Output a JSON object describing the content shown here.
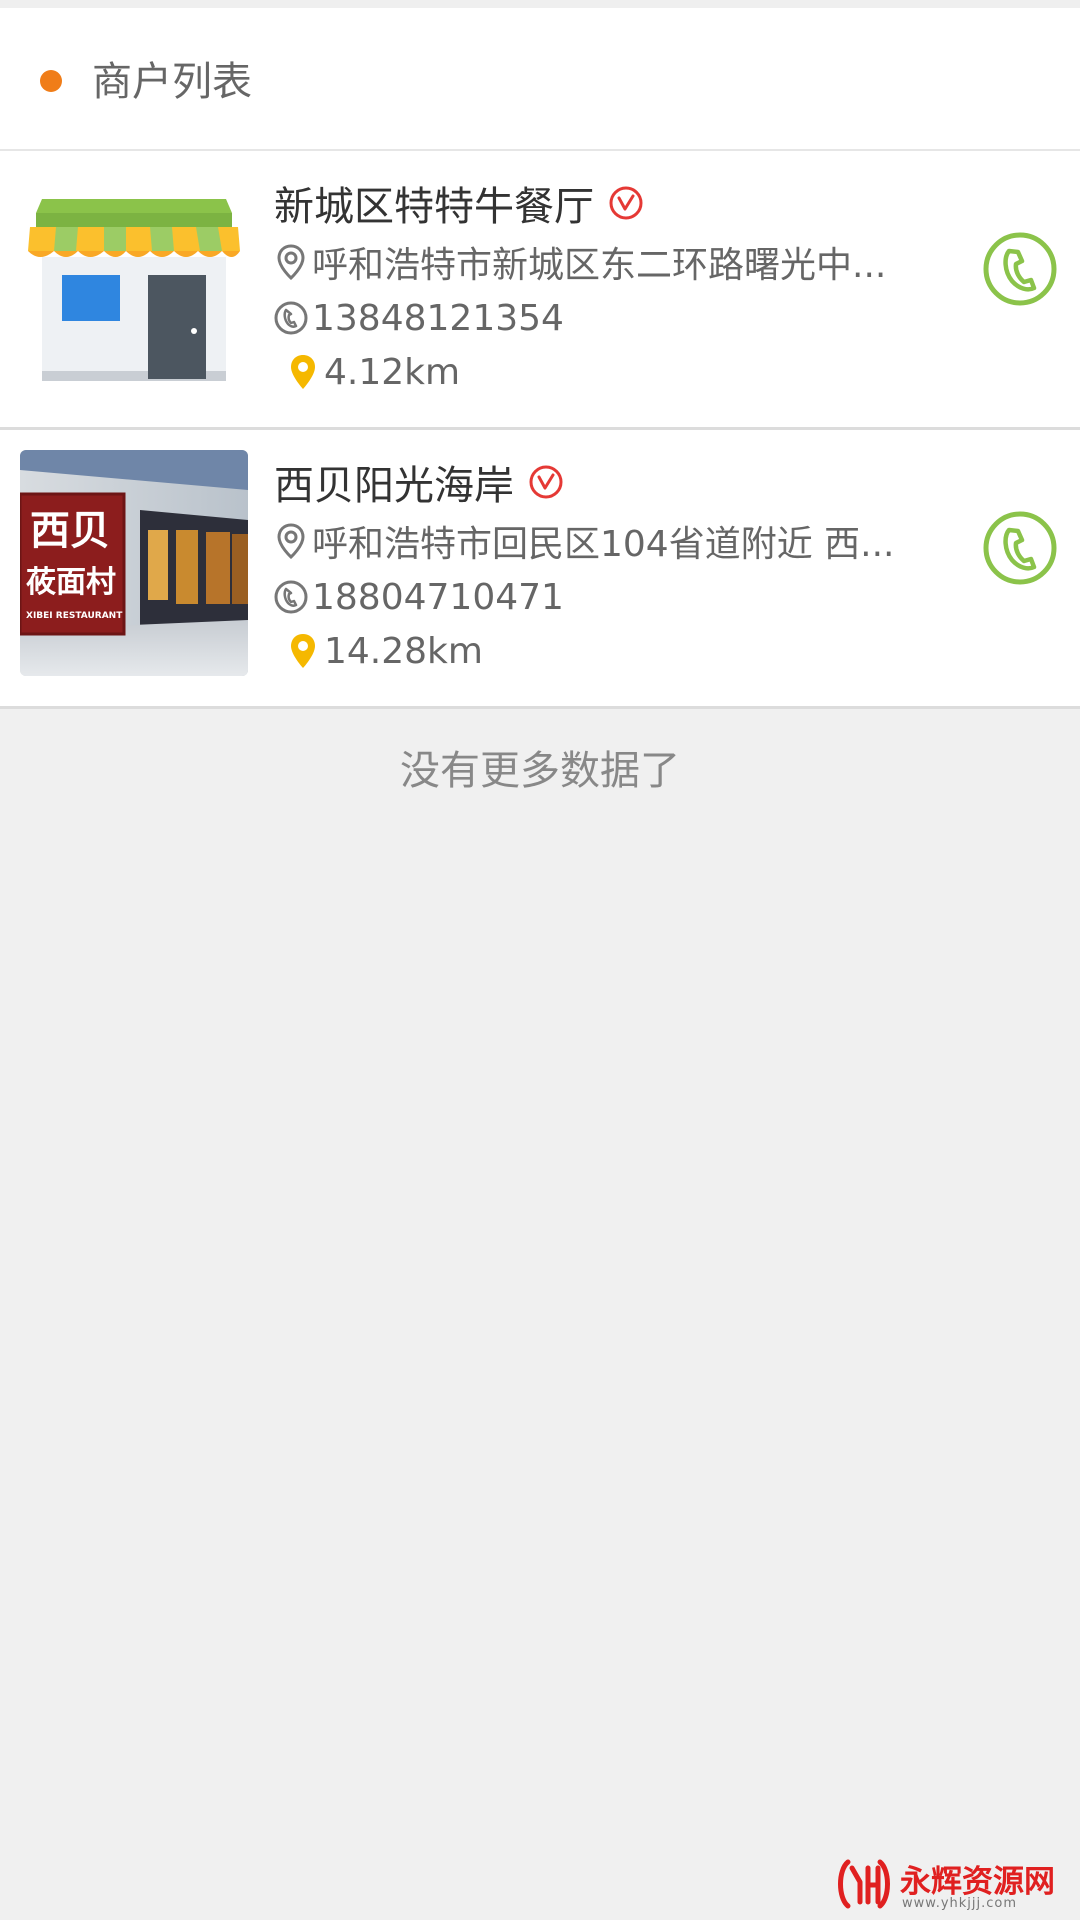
{
  "header": {
    "title": "商户列表"
  },
  "merchants": [
    {
      "name": "新城区特特牛餐厅",
      "address": "呼和浩特市新城区东二环路曙光中...",
      "phone": "13848121354",
      "distance": "4.12km",
      "thumb_icon": "storefront-icon"
    },
    {
      "name": "西贝阳光海岸",
      "address": "呼和浩特市回民区104省道附近 西...",
      "phone": "18804710471",
      "distance": "14.28km",
      "thumb_icon": "restaurant-photo",
      "thumb_sign_line1": "西贝",
      "thumb_sign_line2": "莜面村",
      "thumb_sign_line3": "XIBEI RESTAURANT"
    }
  ],
  "footer": {
    "no_more_text": "没有更多数据了"
  },
  "watermark": {
    "text": "永辉资源网",
    "url": "www.yhkjjj.com"
  },
  "colors": {
    "accent_orange": "#f07d18",
    "call_green": "#8bc34a",
    "badge_red": "#e53935",
    "pin_yellow": "#f5b800"
  }
}
